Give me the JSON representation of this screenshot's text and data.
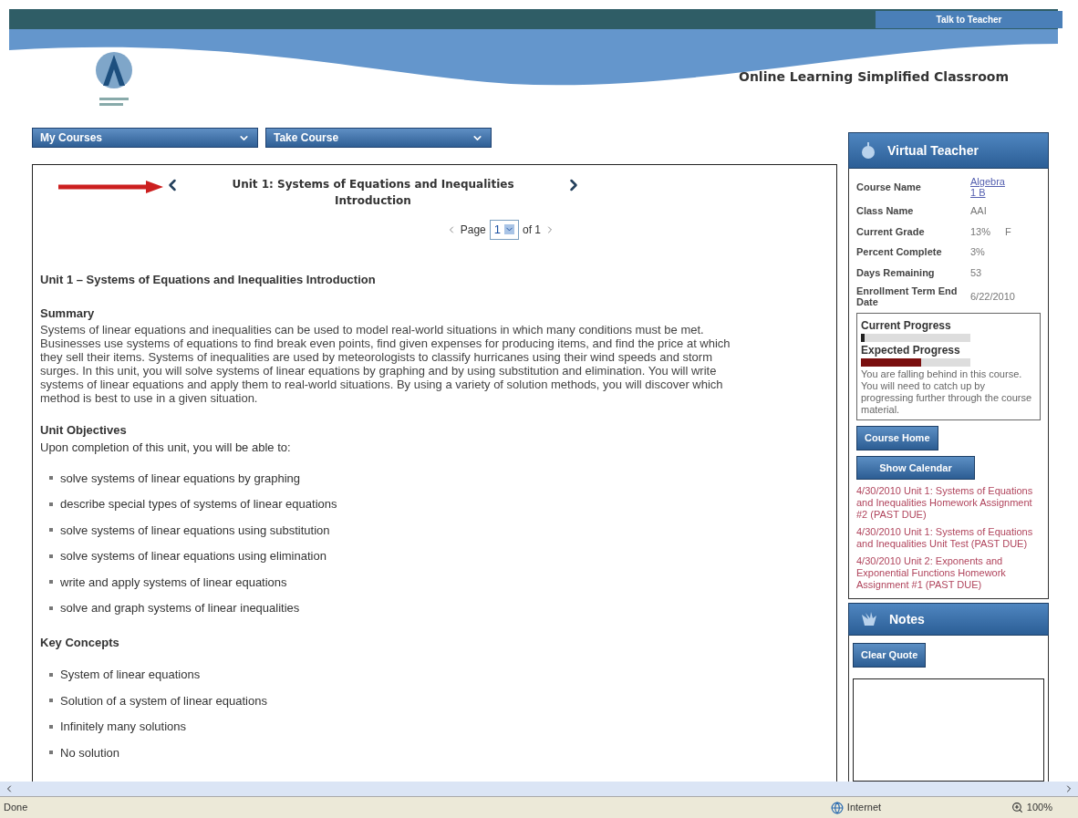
{
  "top_bar": {
    "talk_button": "Talk to Teacher"
  },
  "header": {
    "title": "Online Learning Simplified Classroom"
  },
  "nav_menus": [
    {
      "label": "My Courses"
    },
    {
      "label": "Take Course"
    }
  ],
  "lesson": {
    "title": "Unit 1: Systems of Equations and Inequalities Introduction",
    "pager": {
      "label": "Page",
      "value": "1",
      "total": "of 1"
    },
    "heading": "Unit 1 – Systems of Equations and Inequalities Introduction",
    "summary": {
      "title": "Summary",
      "text": "Systems of linear equations and inequalities can be used to model real-world situations in which many conditions must be met.  Businesses use systems of equations to find break even points, find given expenses for producing items, and find the price at which they sell their items.  Systems of inequalities are used by meteorologists to classify hurricanes using their wind speeds and storm surges. In this unit, you will solve systems of linear equations by graphing and by using substitution and elimination.  You will write systems of linear equations and apply them to real-world situations. By using a variety of solution methods, you will discover which method is best to use in a given situation."
    },
    "objectives": {
      "title": "Unit Objectives",
      "intro": "Upon completion of this unit, you will be able to:",
      "items": [
        "solve systems of linear equations by graphing",
        "describe special types of systems of linear equations",
        "solve systems of linear equations using substitution",
        "solve systems of linear equations using elimination",
        "write and apply systems of linear equations",
        "solve and graph systems of linear inequalities"
      ]
    },
    "key_concepts": {
      "title": "Key Concepts",
      "items": [
        "System of linear equations",
        "Solution of a system of linear equations",
        "Infinitely many solutions",
        "No solution"
      ]
    }
  },
  "virtual_teacher": {
    "title": "Virtual Teacher",
    "fields": [
      {
        "label": "Course Name",
        "value": "Algebra 1 B",
        "kind": "link"
      },
      {
        "label": "Class Name",
        "value": "AAI",
        "kind": "text"
      },
      {
        "label": "Current Grade",
        "value": "13%",
        "grade": "F",
        "kind": "text"
      },
      {
        "label": "Percent Complete",
        "value": "3%",
        "kind": "text"
      },
      {
        "label": "Days Remaining",
        "value": "53",
        "kind": "text"
      },
      {
        "label": "Enrollment Term End Date",
        "value": "6/22/2010",
        "kind": "text"
      }
    ],
    "progress": [
      {
        "label": "Current Progress",
        "level": 0.03
      },
      {
        "label": "Expected Progress",
        "level": 0.55
      }
    ],
    "message": "You are falling behind in this course. You will need to catch up by progressing further through the course material.",
    "buttons": [
      "Course Home",
      "Show Calendar"
    ],
    "calendar": [
      "4/30/2010 Unit 1: Systems of Equations and Inequalities Homework Assignment #2 (PAST DUE)",
      "4/30/2010 Unit 1: Systems of Equations and Inequalities Unit Test (PAST DUE)",
      "4/30/2010 Unit 2: Exponents and Exponential Functions Homework Assignment #1 (PAST DUE)"
    ]
  },
  "notes": {
    "title": "Notes",
    "button": "Clear Quote"
  },
  "status_bar": {
    "text": "Done",
    "zone": "Internet",
    "zoom": "100%"
  }
}
